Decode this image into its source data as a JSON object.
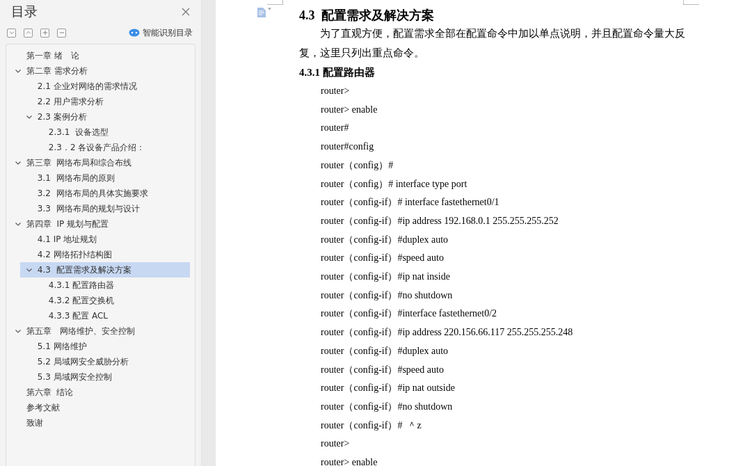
{
  "sidebar": {
    "title": "目录",
    "smart_toc_label": "智能识别目录",
    "toc": [
      {
        "label": "第一章 绪　论",
        "selected": false
      },
      {
        "label": "第二章 需求分析",
        "selected": false,
        "expanded": true,
        "children": [
          {
            "label": "2.1 企业对网络的需求情况",
            "selected": false
          },
          {
            "label": "2.2 用户需求分析",
            "selected": false
          },
          {
            "label": "2.3 案例分析",
            "selected": false,
            "expanded": true,
            "children": [
              {
                "label": "2.3.1  设备选型",
                "selected": false
              },
              {
                "label": "2.3．2 各设备产品介绍：",
                "selected": false
              }
            ]
          }
        ]
      },
      {
        "label": "第三章  网络布局和综合布线",
        "selected": false,
        "expanded": true,
        "children": [
          {
            "label": "3.1  网络布局的原则",
            "selected": false
          },
          {
            "label": "3.2  网络布局的具体实施要求",
            "selected": false
          },
          {
            "label": "3.3  网络布局的规划与设计",
            "selected": false
          }
        ]
      },
      {
        "label": "第四章  IP 规划与配置",
        "selected": false,
        "expanded": true,
        "children": [
          {
            "label": "4.1 IP 地址规划",
            "selected": false
          },
          {
            "label": "4.2 网络拓扑结构图",
            "selected": false
          },
          {
            "label": "4.3  配置需求及解决方案",
            "selected": true,
            "expanded": true,
            "children": [
              {
                "label": "4.3.1 配置路由器",
                "selected": false
              },
              {
                "label": "4.3.2 配置交换机",
                "selected": false
              },
              {
                "label": "4.3.3 配置 ACL",
                "selected": false
              }
            ]
          }
        ]
      },
      {
        "label": "第五章　网络维护、安全控制",
        "selected": false,
        "expanded": true,
        "children": [
          {
            "label": "5.1 网络维护",
            "selected": false
          },
          {
            "label": "5.2 局域网安全威胁分析",
            "selected": false
          },
          {
            "label": "5.3 局域网安全控制",
            "selected": false
          }
        ]
      },
      {
        "label": "第六章  结论",
        "selected": false
      },
      {
        "label": "参考文献",
        "selected": false
      },
      {
        "label": "致谢",
        "selected": false
      }
    ]
  },
  "document": {
    "heading": "4.3  配置需求及解决方案",
    "paragraph": "为了直观方便，配置需求全部在配置命令中加以单点说明，并且配置命令量大反复，这里只列出重点命令。",
    "subheading": "4.3.1 配置路由器",
    "code_lines": [
      "router>",
      "router> enable",
      "router#",
      "router#config",
      "router（config）#",
      "router（config）# interface type port",
      "router（config-if）# interface fastethernet0/1",
      "router（config-if）#ip address 192.168.0.1 255.255.255.252",
      "router（config-if）#duplex auto",
      "router（config-if）#speed auto",
      "router（config-if）#ip nat inside",
      "router（config-if）#no shutdown",
      "router（config-if）#interface fastethernet0/2",
      "router（config-if）#ip address 220.156.66.117 255.255.255.248",
      "router（config-if）#duplex auto",
      "router（config-if）#speed auto",
      "router（config-if）#ip nat outside",
      "router（config-if）#no shutdown",
      "router（config-if）#  ＾z",
      "router>",
      "router> enable"
    ]
  }
}
